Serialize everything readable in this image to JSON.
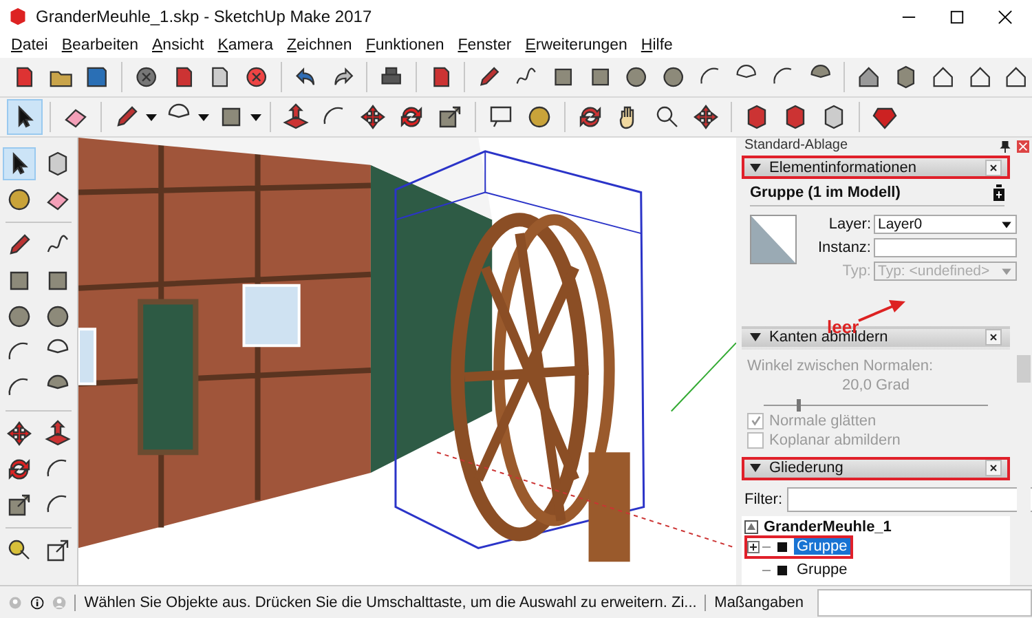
{
  "window": {
    "title": "GranderMeuhle_1.skp - SketchUp Make 2017"
  },
  "menu": [
    "Datei",
    "Bearbeiten",
    "Ansicht",
    "Kamera",
    "Zeichnen",
    "Funktionen",
    "Fenster",
    "Erweiterungen",
    "Hilfe"
  ],
  "toolbars": {
    "select_tool_selected": true
  },
  "tray": {
    "title": "Standard-Ablage",
    "entity_info": {
      "title": "Elementinformationen",
      "highlighted": true,
      "heading": "Gruppe (1 im Modell)",
      "fields": [
        {
          "label": "Layer:",
          "value": "Layer0",
          "kind": "select",
          "disabled": false
        },
        {
          "label": "Instanz:",
          "kind": "input",
          "disabled": false
        },
        {
          "label": "Typ:",
          "value": "Typ: <undefined>",
          "kind": "select",
          "disabled": true
        }
      ],
      "annotation": "leer"
    },
    "soften": {
      "title": "Kanten abmildern",
      "label": "Winkel zwischen Normalen:",
      "reading": "20,0  Grad",
      "level": 0.15,
      "checkboxes": [
        {
          "label": "Normale glätten",
          "checked": true,
          "disabled": true
        },
        {
          "label": "Koplanar abmildern",
          "checked": false,
          "disabled": true
        }
      ]
    },
    "outliner": {
      "title": "Gliederung",
      "highlighted": true,
      "filter_label": "Filter:",
      "root": {
        "label": "GranderMeuhle_1",
        "children": [
          {
            "label": "Gruppe",
            "selected": true,
            "highlighted": true,
            "expandable": true
          },
          {
            "label": "Gruppe",
            "selected": false,
            "highlighted": false,
            "expandable": false
          }
        ]
      }
    }
  },
  "status_bar": {
    "message": "Wählen Sie Objekte aus. Drücken Sie die Umschalttaste, um die Auswahl zu erweitern. Zi...",
    "measurements_label": "Maßangaben"
  }
}
